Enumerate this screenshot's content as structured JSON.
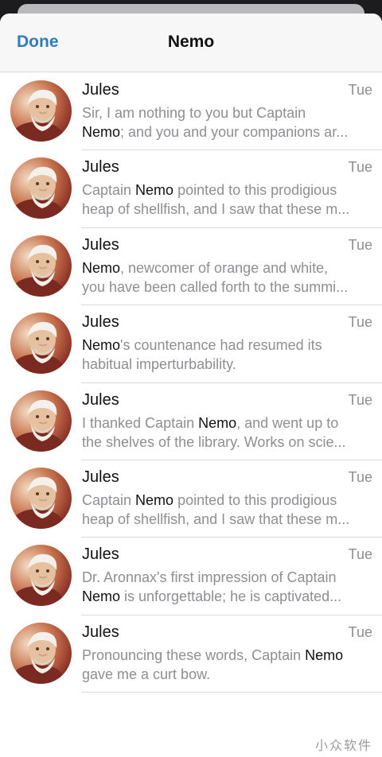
{
  "nav": {
    "done_label": "Done",
    "title": "Nemo"
  },
  "results": [
    {
      "sender": "Jules",
      "date": "Tue",
      "line1": [
        {
          "t": "Sir, I am nothing to you but Captain",
          "h": false
        }
      ],
      "line2": [
        {
          "t": "Nemo",
          "h": true
        },
        {
          "t": "; and you and your companions ar...",
          "h": false
        }
      ]
    },
    {
      "sender": "Jules",
      "date": "Tue",
      "line1": [
        {
          "t": "Captain ",
          "h": false
        },
        {
          "t": "Nemo",
          "h": true
        },
        {
          "t": " pointed to this prodigious",
          "h": false
        }
      ],
      "line2": [
        {
          "t": "heap of shellfish, and I saw that these m...",
          "h": false
        }
      ]
    },
    {
      "sender": "Jules",
      "date": "Tue",
      "line1": [
        {
          "t": "Nemo",
          "h": true
        },
        {
          "t": ", newcomer of orange and white,",
          "h": false
        }
      ],
      "line2": [
        {
          "t": "you have been called forth to the summi...",
          "h": false
        }
      ]
    },
    {
      "sender": "Jules",
      "date": "Tue",
      "line1": [
        {
          "t": "Nemo",
          "h": true
        },
        {
          "t": "'s countenance had resumed its",
          "h": false
        }
      ],
      "line2": [
        {
          "t": "habitual imperturbability.",
          "h": false
        }
      ]
    },
    {
      "sender": "Jules",
      "date": "Tue",
      "line1": [
        {
          "t": "I thanked Captain ",
          "h": false
        },
        {
          "t": "Nemo",
          "h": true
        },
        {
          "t": ", and went up to",
          "h": false
        }
      ],
      "line2": [
        {
          "t": "the shelves of the library. Works on scie...",
          "h": false
        }
      ]
    },
    {
      "sender": "Jules",
      "date": "Tue",
      "line1": [
        {
          "t": "Captain ",
          "h": false
        },
        {
          "t": "Nemo",
          "h": true
        },
        {
          "t": " pointed to this prodigious",
          "h": false
        }
      ],
      "line2": [
        {
          "t": "heap of shellfish, and I saw that these m...",
          "h": false
        }
      ]
    },
    {
      "sender": "Jules",
      "date": "Tue",
      "line1": [
        {
          "t": "Dr. Aronnax's first impression of Captain",
          "h": false
        }
      ],
      "line2": [
        {
          "t": "Nemo",
          "h": true
        },
        {
          "t": " is unforgettable; he is captivated...",
          "h": false
        }
      ]
    },
    {
      "sender": "Jules",
      "date": "Tue",
      "line1": [
        {
          "t": "Pronouncing these words, Captain ",
          "h": false
        },
        {
          "t": "Nemo",
          "h": true
        }
      ],
      "line2": [
        {
          "t": "gave me a curt bow.",
          "h": false
        }
      ]
    }
  ],
  "watermark": "小众软件",
  "colors": {
    "accent": "#2f7cc2",
    "highlight_text": "#111111",
    "secondary_text": "#8e8e93"
  }
}
